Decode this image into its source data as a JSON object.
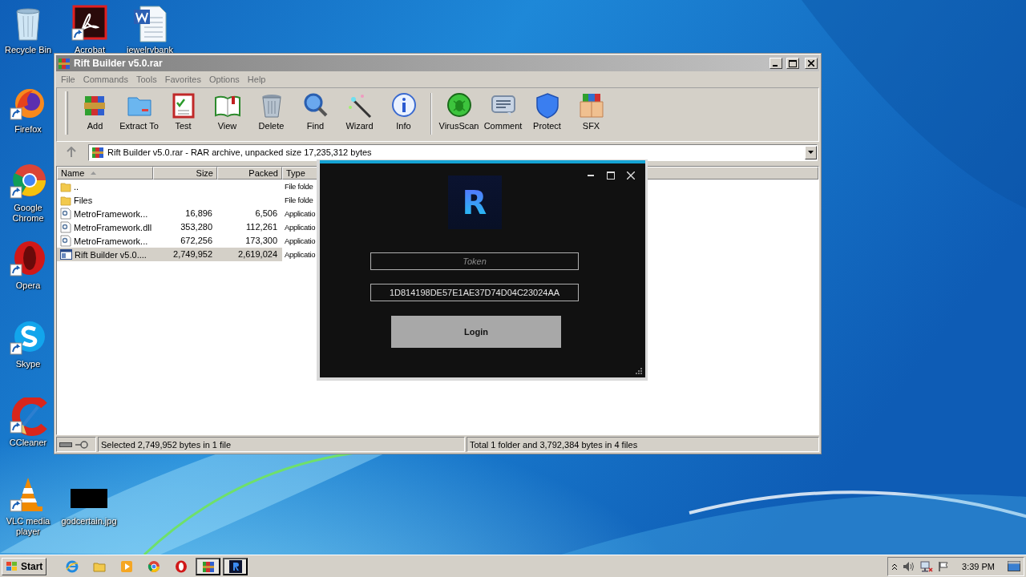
{
  "desktop": {
    "icons": [
      {
        "label": "Recycle Bin"
      },
      {
        "label": "Acrobat"
      },
      {
        "label": "jewelrybank"
      },
      {
        "label": "Firefox"
      },
      {
        "label": "Google Chrome"
      },
      {
        "label": "Opera"
      },
      {
        "label": "Skype"
      },
      {
        "label": "CCleaner"
      },
      {
        "label": "VLC media player"
      },
      {
        "label": "godcertain.jpg"
      }
    ]
  },
  "archive_window": {
    "title": "Rift Builder v5.0.rar",
    "menu": [
      "File",
      "Commands",
      "Tools",
      "Favorites",
      "Options",
      "Help"
    ],
    "toolbar": [
      {
        "label": "Add"
      },
      {
        "label": "Extract To"
      },
      {
        "label": "Test"
      },
      {
        "label": "View"
      },
      {
        "label": "Delete"
      },
      {
        "label": "Find"
      },
      {
        "label": "Wizard"
      },
      {
        "label": "Info"
      },
      {
        "label": "VirusScan"
      },
      {
        "label": "Comment"
      },
      {
        "label": "Protect"
      },
      {
        "label": "SFX"
      }
    ],
    "address": "Rift Builder v5.0.rar - RAR archive, unpacked size 17,235,312 bytes",
    "columns": [
      "Name",
      "Size",
      "Packed",
      "Type"
    ],
    "rows": [
      {
        "kind": "folder",
        "name": "..",
        "type": "File folde",
        "selected": false
      },
      {
        "kind": "folder",
        "name": "Files",
        "type": "File folde",
        "selected": false
      },
      {
        "kind": "library",
        "name": "MetroFramework...",
        "size": "16,896",
        "packed": "6,506",
        "type": "Applicatio",
        "selected": false
      },
      {
        "kind": "library",
        "name": "MetroFramework.dll",
        "size": "353,280",
        "packed": "112,261",
        "type": "Applicatio",
        "selected": false
      },
      {
        "kind": "library",
        "name": "MetroFramework...",
        "size": "672,256",
        "packed": "173,300",
        "type": "Applicatio",
        "selected": false
      },
      {
        "kind": "program",
        "name": "Rift Builder v5.0....",
        "size": "2,749,952",
        "packed": "2,619,024",
        "type": "Applicatio",
        "selected": true
      }
    ],
    "status_left": "Selected 2,749,952 bytes in 1 file",
    "status_right": "Total 1 folder and 3,792,384 bytes in 4 files"
  },
  "login_dialog": {
    "logo": "R",
    "token_placeholder": "Token",
    "key_value": "1D814198DE57E1AE37D74D04C23024AA",
    "button": "Login"
  },
  "taskbar": {
    "start": "Start",
    "apps": [
      {
        "active": false
      },
      {
        "active": false
      },
      {
        "active": false
      },
      {
        "active": false
      },
      {
        "active": false
      },
      {
        "active": true
      },
      {
        "active": true
      }
    ],
    "clock": "3:39 PM"
  }
}
